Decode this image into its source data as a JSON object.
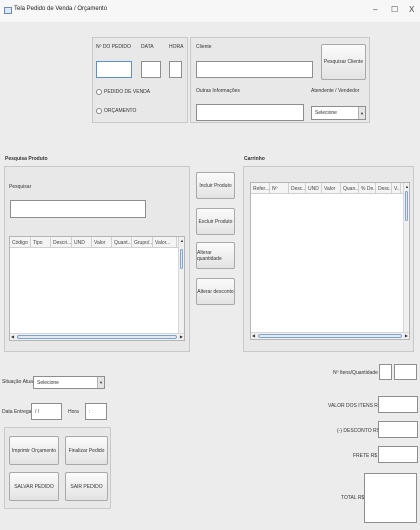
{
  "window": {
    "title": "Tela Pedido de Venda / Orçamento",
    "minimize": "–",
    "maximize": "☐",
    "close": "X"
  },
  "header": {
    "pedido_label": "Nº DO PEDIDO",
    "data_label": "DATA",
    "hora_label": "HORA",
    "radio_pedido": "PEDIDO DE VENDA",
    "radio_orcamento": "ORÇAMENTO"
  },
  "cliente": {
    "label": "Cliente",
    "pesquisar_button": "Pesquisar Cliente",
    "outras_label": "Outras Informações",
    "atendente_label": "Atendente / Vendedor",
    "atendente_value": "Selecione"
  },
  "produto": {
    "section_label": "Pesquisa Produto",
    "search_label": "Pesquisar",
    "columns": [
      "Código",
      "Tipo",
      "Descri...",
      "UND",
      "Valor",
      "Quant...",
      "Grupo/...",
      "Valor..."
    ]
  },
  "actions": {
    "incluir": "Incluir Produto",
    "excluir": "Excluir Produto",
    "alterar_qtd": "Alterar quantidade",
    "alterar_desc": "Alterar desconto"
  },
  "carrinho": {
    "section_label": "Carrinho",
    "columns": [
      "Refer...",
      "Nº",
      "Desc...",
      "UND",
      "Valor",
      "Quan...",
      "% De...",
      "Desc...",
      "V..."
    ]
  },
  "bottom": {
    "situacao_label": "Situação Atual",
    "situacao_value": "Selecione",
    "data_entrega_label": "Data Entrega",
    "data_entrega_value": " / /",
    "hora_label": "Hora",
    "hora_value": " :",
    "imprimir": "Imprimir Orçamento",
    "finalizar": "Finalizar Pedido",
    "salvar": "SALVAR PEDIDO",
    "sair": "SAIR PEDIDO"
  },
  "totals": {
    "itens_qtd_label": "Nº Itens/Quantidade",
    "valor_itens_label": "VALOR DOS ITENS R$",
    "desconto_label": "(-) DESCONTO R$",
    "frete_label": "FRETE R$",
    "total_label": "TOTAL R$"
  }
}
